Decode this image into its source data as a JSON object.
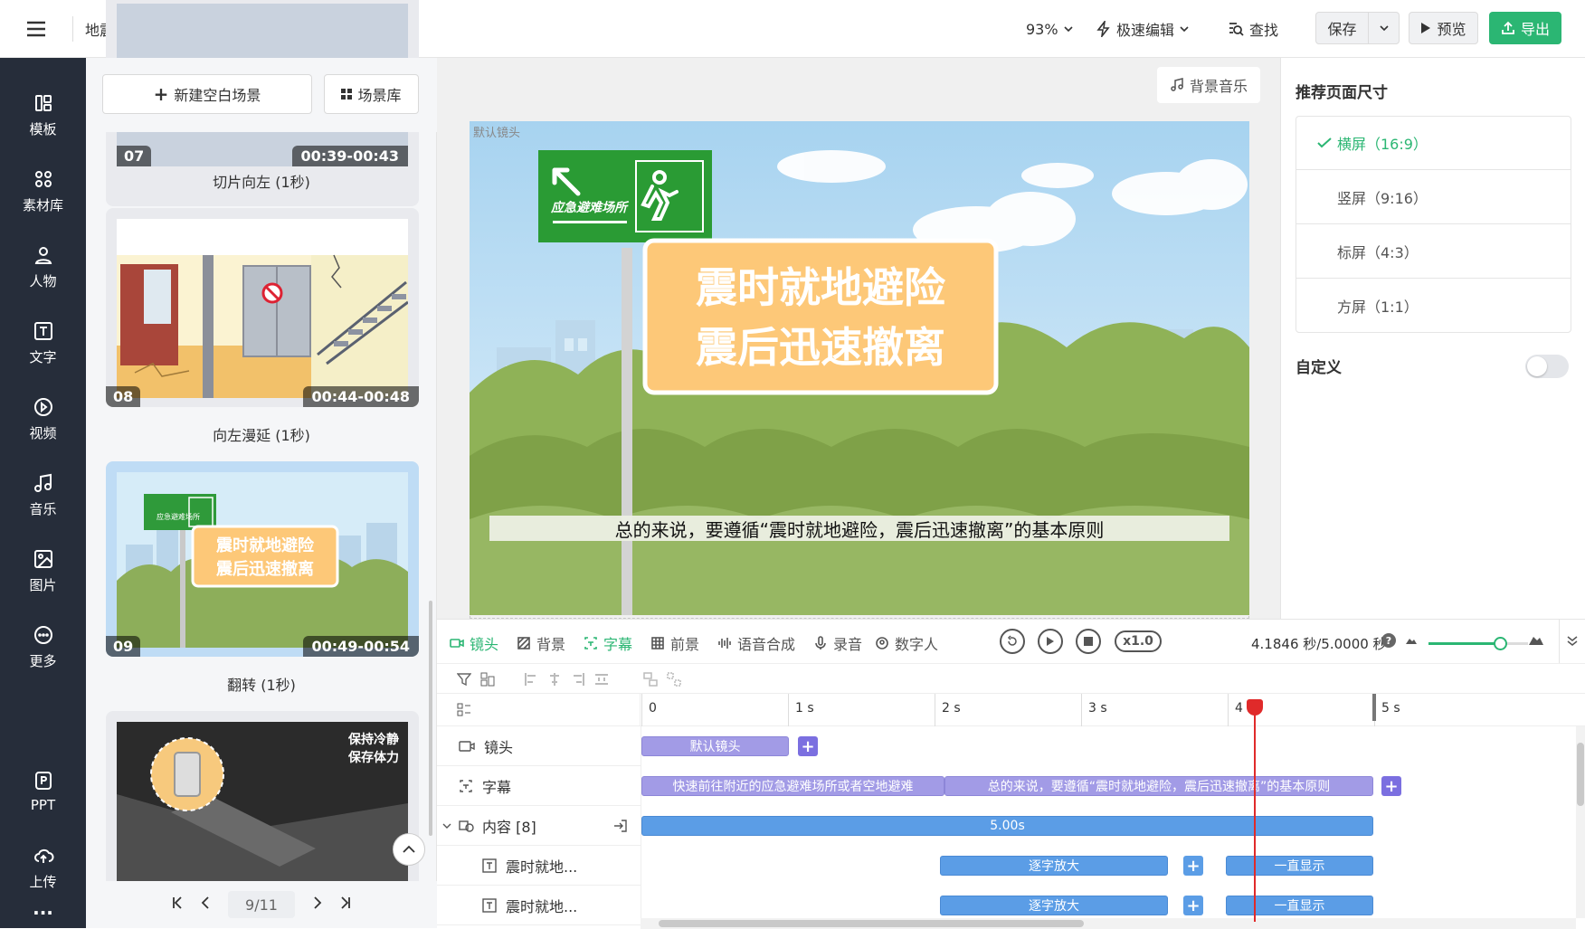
{
  "header": {
    "project_title": "地震逃生小知...",
    "zoom": "93%",
    "edit_mode": "极速编辑",
    "find": "查找",
    "save": "保存",
    "preview": "预览",
    "export": "导出"
  },
  "nav": {
    "items": [
      {
        "label": "模板",
        "icon": "template-icon"
      },
      {
        "label": "素材库",
        "icon": "material-icon"
      },
      {
        "label": "人物",
        "icon": "person-icon"
      },
      {
        "label": "文字",
        "icon": "text-icon"
      },
      {
        "label": "视频",
        "icon": "video-icon"
      },
      {
        "label": "音乐",
        "icon": "music-icon"
      },
      {
        "label": "图片",
        "icon": "image-icon"
      },
      {
        "label": "更多",
        "icon": "more-icon"
      }
    ],
    "bottom": [
      {
        "label": "PPT",
        "icon": "ppt-icon"
      },
      {
        "label": "上传",
        "icon": "upload-icon"
      }
    ],
    "ellipsis": "..."
  },
  "scenes": {
    "new_scene": "新建空白场景",
    "library": "场景库",
    "items": [
      {
        "num": "07",
        "time": "00:39-00:43",
        "transition": "切片向左 (1秒)"
      },
      {
        "num": "08",
        "time": "00:44-00:48",
        "transition": "向左漫延 (1秒)"
      },
      {
        "num": "09",
        "time": "00:49-00:54",
        "transition": "翻转 (1秒)"
      },
      {
        "num": "",
        "time": "",
        "transition": ""
      }
    ],
    "page_input": "9/11",
    "thumb9_line1": "震时就地避险",
    "thumb9_line2": "震后迅速撤离",
    "thumb10_line1": "保持冷静",
    "thumb10_line2": "保存体力",
    "thumb_sign": "应急避难场所"
  },
  "canvas": {
    "bg_music": "背景音乐",
    "camera_label": "默认镜头",
    "sign_text": "应急避难场所",
    "board_line1": "震时就地避险",
    "board_line2": "震后迅速撤离",
    "subtitle": "总的来说，要遵循“震时就地避险，震后迅速撤离”的基本原则"
  },
  "right_panel": {
    "title": "推荐页面尺寸",
    "ratios": [
      {
        "label": "横屏（16:9）",
        "selected": true
      },
      {
        "label": "竖屏（9:16）",
        "selected": false
      },
      {
        "label": "标屏（4:3）",
        "selected": false
      },
      {
        "label": "方屏（1:1）",
        "selected": false
      }
    ],
    "custom": "自定义",
    "custom_enabled": false
  },
  "timeline": {
    "tabs": [
      {
        "label": "镜头",
        "icon": "camera-icon",
        "active": true
      },
      {
        "label": "背景",
        "icon": "background-icon",
        "active": false
      },
      {
        "label": "字幕",
        "icon": "subtitle-icon",
        "active": true
      },
      {
        "label": "前景",
        "icon": "foreground-icon",
        "active": false
      },
      {
        "label": "语音合成",
        "icon": "tts-icon",
        "active": false
      },
      {
        "label": "录音",
        "icon": "mic-icon",
        "active": false
      },
      {
        "label": "数字人",
        "icon": "avatar-icon",
        "active": false
      }
    ],
    "speed": "x1.0",
    "time_display": "4.1846 秒/5.0000 秒",
    "zoom_level": 0.72,
    "ruler": [
      "0",
      "1 s",
      "2 s",
      "3 s",
      "4 s",
      "5 s"
    ],
    "tracks": {
      "camera": {
        "label": "镜头",
        "clip": "默认镜头"
      },
      "subtitle": {
        "label": "字幕",
        "clips": [
          "快速前往附近的应急避难场所或者空地避难",
          "总的来说，要遵循“震时就地避险，震后迅速撤离”的基本原则"
        ]
      },
      "content": {
        "label": "内容 [8]",
        "clip": "5.00s"
      },
      "layers": [
        {
          "label": "震时就地...",
          "effect": "逐字放大",
          "hold": "一直显示"
        },
        {
          "label": "震时就地...",
          "effect": "逐字放大",
          "hold": "一直显示"
        }
      ]
    },
    "playhead_seconds": 4.1846,
    "total_seconds": 5.0
  },
  "colors": {
    "accent_green": "#2bb673",
    "nav_bg": "#262d3a",
    "clip_purple": "#a29be6",
    "clip_blue": "#5b9de6",
    "playhead": "#e02a2a"
  }
}
